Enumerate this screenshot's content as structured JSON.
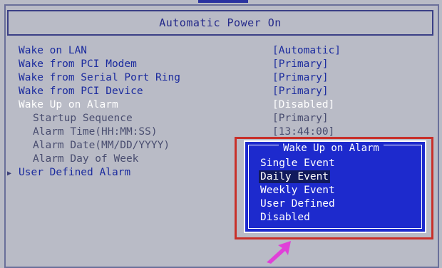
{
  "title": "Automatic Power On",
  "settings": [
    {
      "label": "Wake on LAN",
      "value": "[Automatic]"
    },
    {
      "label": "Wake from PCI Modem",
      "value": "[Primary]"
    },
    {
      "label": "Wake from Serial Port Ring",
      "value": "[Primary]"
    },
    {
      "label": "Wake from PCI Device",
      "value": "[Primary]"
    },
    {
      "label": "Wake Up on Alarm",
      "value": "[Disabled]"
    },
    {
      "label": "Startup Sequence",
      "value": "[Primary]"
    },
    {
      "label": "Alarm Time(HH:MM:SS)",
      "value": "[13:44:00]"
    },
    {
      "label": "Alarm Date(MM/DD/YYYY)",
      "value": ""
    },
    {
      "label": "Alarm Day of Week",
      "value": ""
    },
    {
      "label": "User Defined Alarm",
      "value": ""
    }
  ],
  "popup": {
    "title": "Wake Up on Alarm",
    "options": [
      "Single Event",
      "Daily Event",
      "Weekly Event",
      "User Defined",
      "Disabled"
    ],
    "selected": "Daily Event"
  },
  "colors": {
    "background": "#b9bbc6",
    "text_blue": "#1b2b9e",
    "popup_blue": "#1d2acd",
    "annotation_red": "#c8302a",
    "annotation_arrow": "#e040d8"
  }
}
